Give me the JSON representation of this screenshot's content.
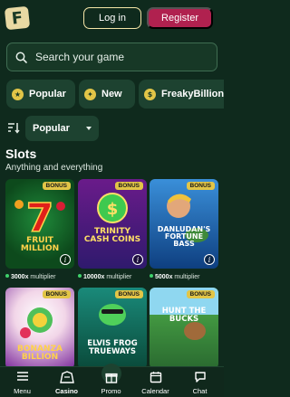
{
  "header": {
    "logo_letter": "F",
    "login_label": "Log in",
    "register_label": "Register"
  },
  "search": {
    "placeholder": "Search your game",
    "icon": "search-icon"
  },
  "chips": [
    {
      "label": "Popular",
      "icon": "star-icon"
    },
    {
      "label": "New",
      "icon": "new-icon"
    },
    {
      "label": "FreakyBillion",
      "icon": "coin-icon"
    }
  ],
  "sort": {
    "icon": "sort-icon",
    "selected": "Popular"
  },
  "section": {
    "title": "Slots",
    "subtitle": "Anything and everything"
  },
  "games": [
    {
      "title": "FRUIT MILLION",
      "badge": "BONUS",
      "multiplier": "3000x",
      "multiplier_label": "multiplier"
    },
    {
      "title": "TRINITY CASH COINS",
      "badge": "BONUS",
      "multiplier": "10000x",
      "multiplier_label": "multiplier"
    },
    {
      "title": "DANLUDAN'S FORTUNE BASS",
      "badge": "BONUS",
      "multiplier": "5000x",
      "multiplier_label": "multiplier"
    },
    {
      "title": "BONANZA BILLION",
      "badge": "BONUS"
    },
    {
      "title": "ELVIS FROG TRUEWAYS",
      "badge": "BONUS"
    },
    {
      "title": "HUNT THE BUCKS",
      "badge": "BONUS"
    }
  ],
  "colors": {
    "background": "#0f2a1d",
    "accent_register": "#b0214f",
    "login_border": "#f5e6a8",
    "badge": "#e2c547"
  },
  "bottom_nav": [
    {
      "label": "Menu",
      "icon": "menu-icon"
    },
    {
      "label": "Casino",
      "icon": "casino-icon",
      "active": true
    },
    {
      "label": "Promo",
      "icon": "gift-icon"
    },
    {
      "label": "Calendar",
      "icon": "calendar-icon"
    },
    {
      "label": "Chat",
      "icon": "chat-icon"
    }
  ]
}
